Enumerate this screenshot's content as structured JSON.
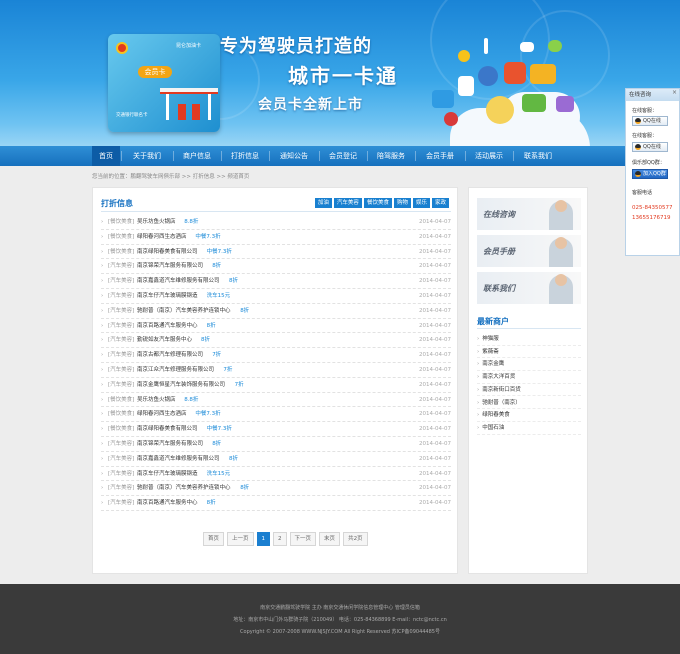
{
  "banner": {
    "card": {
      "brand": "昆仑加油卡",
      "vip": "会员卡",
      "subtext": "交通银行联名卡"
    },
    "slogan1": "专为驾驶员打造的",
    "slogan2": "城市一卡通",
    "slogan3": "会员卡全新上市"
  },
  "nav": [
    "首页",
    "关于我们",
    "商户信息",
    "打折信息",
    "通知公告",
    "会员登记",
    "陪驾服务",
    "会员手册",
    "活动展示",
    "联系我们"
  ],
  "breadcrumb": "您当前的位置：鹏翻驾驶车网俱乐部 >> 打折信息 >> 频道首页",
  "main": {
    "title": "打折信息",
    "categories": [
      "加油",
      "汽车美容",
      "餐饮美食",
      "购物",
      "娱乐",
      "家政"
    ],
    "rows": [
      {
        "tag": "[餐饮美食]",
        "name": "吴乐坊鱼火锅店",
        "offer": "8.8折",
        "date": "2014-04-07"
      },
      {
        "tag": "[餐饮美食]",
        "name": "绿阳春河西生态酒店",
        "offer": "中餐7.3折",
        "date": "2014-04-07"
      },
      {
        "tag": "[餐饮美食]",
        "name": "南京绿阳春美食有限公司",
        "offer": "中餐7.3折",
        "date": "2014-04-07"
      },
      {
        "tag": "[汽车美容]",
        "name": "南京锦荣汽车服务有限公司",
        "offer": "8折",
        "date": "2014-04-07"
      },
      {
        "tag": "[汽车美容]",
        "name": "南京嘉鑫道汽车维修服务有限公司",
        "offer": "8折",
        "date": "2014-04-07"
      },
      {
        "tag": "[汽车美容]",
        "name": "南京车仔汽车玻璃膜钢造",
        "offer": "洗车15元",
        "date": "2014-04-07"
      },
      {
        "tag": "[汽车美容]",
        "name": "驰耐普（南京）汽车美容养护连锁中心",
        "offer": "8折",
        "date": "2014-04-07"
      },
      {
        "tag": "[汽车美容]",
        "name": "南京百路通汽车服务中心",
        "offer": "8折",
        "date": "2014-04-07"
      },
      {
        "tag": "[汽车美容]",
        "name": "勤锐如友汽车服务中心",
        "offer": "8折",
        "date": "2014-04-07"
      },
      {
        "tag": "[汽车美容]",
        "name": "南京古都汽车修理有限公司",
        "offer": "7折",
        "date": "2014-04-07"
      },
      {
        "tag": "[汽车美容]",
        "name": "南京江众汽车修理服务有限公司",
        "offer": "7折",
        "date": "2014-04-07"
      },
      {
        "tag": "[汽车美容]",
        "name": "南京金鹰恒星汽车装饰服务有限公司",
        "offer": "7折",
        "date": "2014-04-07"
      },
      {
        "tag": "[餐饮美食]",
        "name": "吴乐坊鱼火锅店",
        "offer": "8.8折",
        "date": "2014-04-07"
      },
      {
        "tag": "[餐饮美食]",
        "name": "绿阳春河西生态酒店",
        "offer": "中餐7.3折",
        "date": "2014-04-07"
      },
      {
        "tag": "[餐饮美食]",
        "name": "南京绿阳春美食有限公司",
        "offer": "中餐7.3折",
        "date": "2014-04-07"
      },
      {
        "tag": "[汽车美容]",
        "name": "南京锦荣汽车服务有限公司",
        "offer": "8折",
        "date": "2014-04-07"
      },
      {
        "tag": "[汽车美容]",
        "name": "南京嘉鑫道汽车维修服务有限公司",
        "offer": "8折",
        "date": "2014-04-07"
      },
      {
        "tag": "[汽车美容]",
        "name": "南京车仔汽车玻璃膜钢造",
        "offer": "洗车15元",
        "date": "2014-04-07"
      },
      {
        "tag": "[汽车美容]",
        "name": "驰耐普（南京）汽车美容养护连锁中心",
        "offer": "8折",
        "date": "2014-04-07"
      },
      {
        "tag": "[汽车美容]",
        "name": "南京百路通汽车服务中心",
        "offer": "8折",
        "date": "2014-04-07"
      }
    ],
    "pager": [
      "首页",
      "上一页",
      "1",
      "2",
      "下一页",
      "末页",
      "共2页"
    ],
    "pager_current": "1"
  },
  "side": {
    "buttons": [
      "在线咨询",
      "会员手册",
      "联系我们"
    ],
    "title": "最新商户",
    "items": [
      "神猫服",
      "紫薇斋",
      "南京金鹰",
      "南京大洋百货",
      "南京新街口百货",
      "驰耐普（南京）",
      "绿阳春美食",
      "中国石油"
    ]
  },
  "float": {
    "title": "在线咨询",
    "close": "×",
    "labels": [
      "在线客服：",
      "在线客服：",
      "俱乐部QQ群：",
      "客服电话"
    ],
    "qq": [
      "QQ在线",
      "QQ在线",
      "加入QQ群"
    ],
    "phones": [
      "025-84350577",
      "13655176719"
    ]
  },
  "footer": [
    "南京交通鹏翻驾驶学院 主办 南京交通休闲学院信息管理中心 管理员信箱",
    "地址：南京市中山门外马群骑子院（210049） 电话：025-84368899 E-mail：nctc@nctc.cn",
    "Copyright © 2007-2008 WWW.NJSJY.COM All Right Reserved 苏ICP备09044485号"
  ],
  "colors": {
    "accent": "#1980d0",
    "nav": "#1670bd",
    "offer": "#1a8ad8",
    "phone": "#e23a20",
    "footer_bg": "#3a3a3a"
  }
}
